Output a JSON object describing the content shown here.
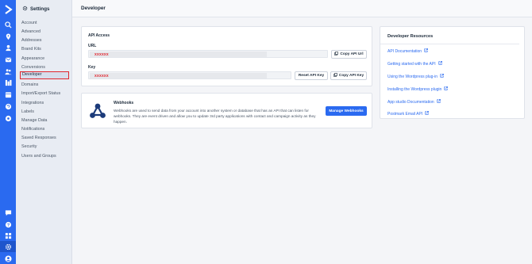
{
  "sidebar": {
    "title": "Settings",
    "items": [
      {
        "label": "Account"
      },
      {
        "label": "Advanced"
      },
      {
        "label": "Addresses"
      },
      {
        "label": "Brand Kits"
      },
      {
        "label": "Appearance"
      },
      {
        "label": "Conversions"
      },
      {
        "label": "Developer",
        "active": true
      },
      {
        "label": "Domains"
      },
      {
        "label": "Import/Export Status"
      },
      {
        "label": "Integrations"
      },
      {
        "label": "Labels"
      },
      {
        "label": "Manage Data"
      },
      {
        "label": "Notifications"
      },
      {
        "label": "Saved Responses"
      },
      {
        "label": "Security"
      },
      {
        "label": "Users and Groups"
      }
    ]
  },
  "rail_icons": [
    "logo-chevron-icon",
    "search-icon",
    "location-icon",
    "contacts-icon",
    "mail-icon",
    "groups-icon",
    "reports-icon",
    "calendar-icon",
    "help-circle-icon",
    "settings-ring-icon",
    "chat-icon",
    "question-icon",
    "apps-icon",
    "settings-gear-icon",
    "avatar-icon"
  ],
  "header": {
    "title": "Developer"
  },
  "api_access": {
    "heading": "API Access",
    "url_label": "URL",
    "url_value": "xxxxxx",
    "copy_url_label": "Copy API Url",
    "key_label": "Key",
    "key_value": "xxxxxx",
    "reset_key_label": "Reset API Key",
    "copy_key_label": "Copy API Key"
  },
  "webhooks": {
    "title": "Webhooks",
    "description": "Webhooks are used to send data from your account into another system or database that has an API that can listen for webhooks. They are event driven and allow you to update 3rd party applications with contact and campaign activity as they happen.",
    "button_label": "Manage Webhooks"
  },
  "resources": {
    "title": "Developer Resources",
    "links": [
      {
        "label": "API Documentation"
      },
      {
        "label": "Getting started with the API"
      },
      {
        "label": "Using the Wordpress plug-in"
      },
      {
        "label": "Installing the Wordpress plugin"
      },
      {
        "label": "App studio Documentation"
      },
      {
        "label": "Postmark Email API"
      }
    ]
  },
  "colors": {
    "brand": "#2a6af0",
    "highlight_border": "#e0262e",
    "masked_value": "#e0262e"
  }
}
